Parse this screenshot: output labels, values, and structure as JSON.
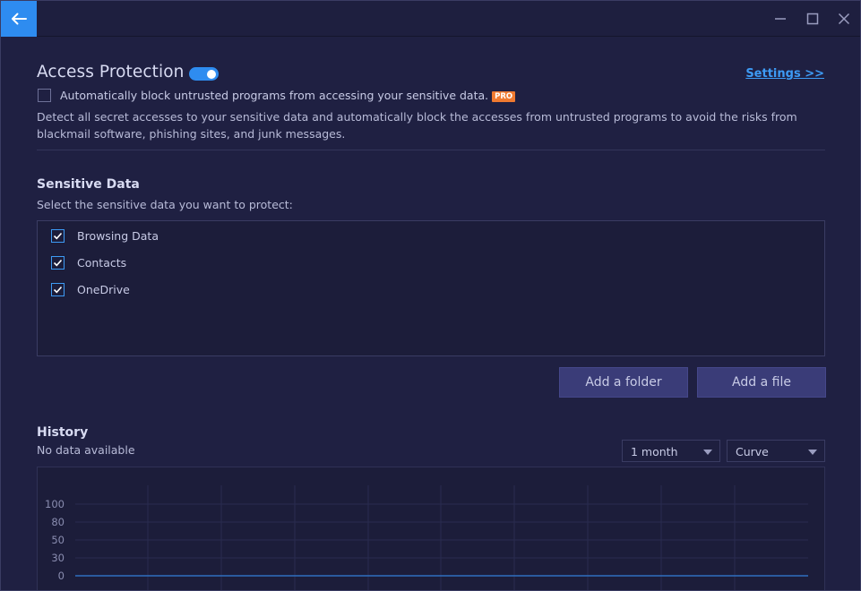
{
  "window": {
    "controls": [
      "minimize-icon",
      "maximize-icon",
      "close-icon"
    ]
  },
  "header": {
    "title": "Access Protection",
    "toggle_on": true,
    "settings_link": "Settings >>"
  },
  "auto_block": {
    "label": "Automatically block untrusted programs from accessing your sensitive data.",
    "checked": false,
    "badge": "PRO"
  },
  "description": "Detect all secret accesses to your sensitive data and automatically block the accesses from untrusted programs to avoid the risks from blackmail software, phishing sites, and junk messages.",
  "sensitive": {
    "title": "Sensitive Data",
    "subtitle": "Select the sensitive data you want to protect:",
    "items": [
      {
        "label": "Browsing Data",
        "checked": true
      },
      {
        "label": "Contacts",
        "checked": true
      },
      {
        "label": "OneDrive",
        "checked": true
      }
    ],
    "add_folder": "Add a folder",
    "add_file": "Add a file"
  },
  "history": {
    "title": "History",
    "status": "No data available",
    "period_select": "1 month",
    "style_select": "Curve"
  },
  "colors": {
    "accent": "#2e8cf0",
    "pro_badge": "#f07a30",
    "background": "#1f2042"
  },
  "chart_data": {
    "type": "line",
    "ylim": [
      0,
      100
    ],
    "y_ticks": [
      "100",
      "80",
      "50",
      "30",
      "0"
    ],
    "series": [],
    "grid": true
  }
}
